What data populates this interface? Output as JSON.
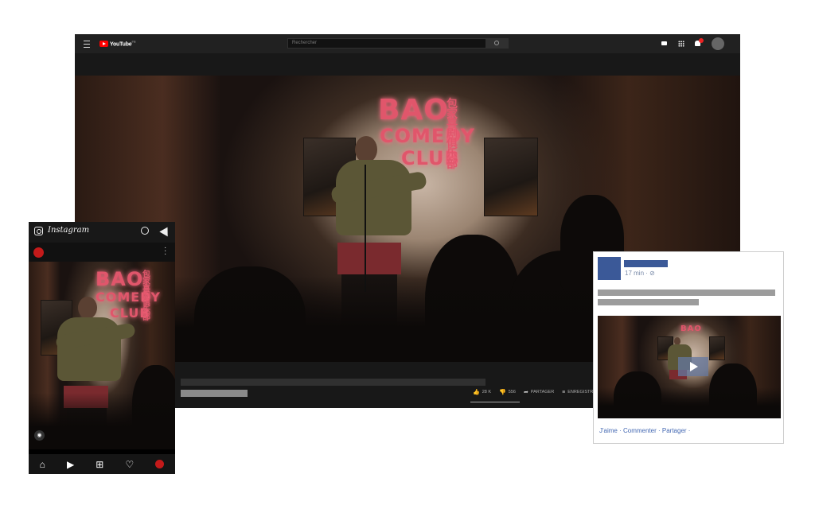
{
  "youtube": {
    "logo_text": "YouTube",
    "logo_suffix": "FR",
    "search_placeholder": "Rechercher",
    "video": {
      "sign_en_1": "BAO",
      "sign_en_2": "COMEDY",
      "sign_en_3": "CLUB",
      "sign_cn": "包家喜剧俱乐部"
    },
    "actions": {
      "likes": "28 K",
      "dislikes": "556",
      "share": "PARTAGER",
      "save": "ENREGISTRER"
    }
  },
  "instagram": {
    "title": "Instagram"
  },
  "facebook": {
    "time": "17 min · ⊘",
    "actions": "J'aime · Commenter · Partager ·"
  },
  "colors": {
    "youtube_red": "#ff0000",
    "facebook_blue": "#3b5998",
    "neon_pink": "#e0566b"
  }
}
